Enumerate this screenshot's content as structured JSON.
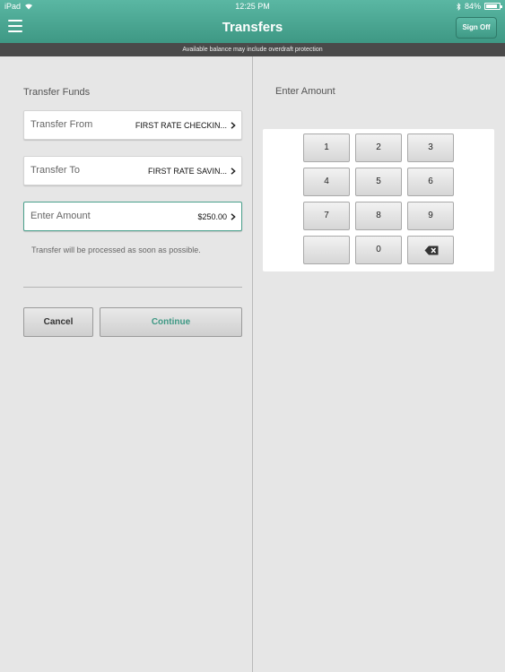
{
  "status": {
    "carrier": "iPad",
    "time": "12:25 PM",
    "battery": "84%",
    "battery_level": 0.84
  },
  "header": {
    "title": "Transfers",
    "sign_off": "Sign Off"
  },
  "notice": "Available balance may include overdraft protection",
  "transfer_form": {
    "title": "Transfer Funds",
    "from_label": "Transfer From",
    "from_value": "FIRST RATE CHECKIN...",
    "to_label": "Transfer To",
    "to_value": "FIRST RATE SAVIN...",
    "amount_label": "Enter Amount",
    "amount_value": "$250.00",
    "note": "Transfer will be processed as soon as possible.",
    "cancel": "Cancel",
    "continue": "Continue"
  },
  "keypad": {
    "title": "Enter Amount",
    "keys": {
      "k1": "1",
      "k2": "2",
      "k3": "3",
      "k4": "4",
      "k5": "5",
      "k6": "6",
      "k7": "7",
      "k8": "8",
      "k9": "9",
      "blank": "",
      "k0": "0"
    },
    "backspace_icon": "backspace-icon"
  },
  "colors": {
    "brand": "#4aa08c",
    "notice_bar": "#4a4a4a",
    "background": "#e6e6e6"
  }
}
